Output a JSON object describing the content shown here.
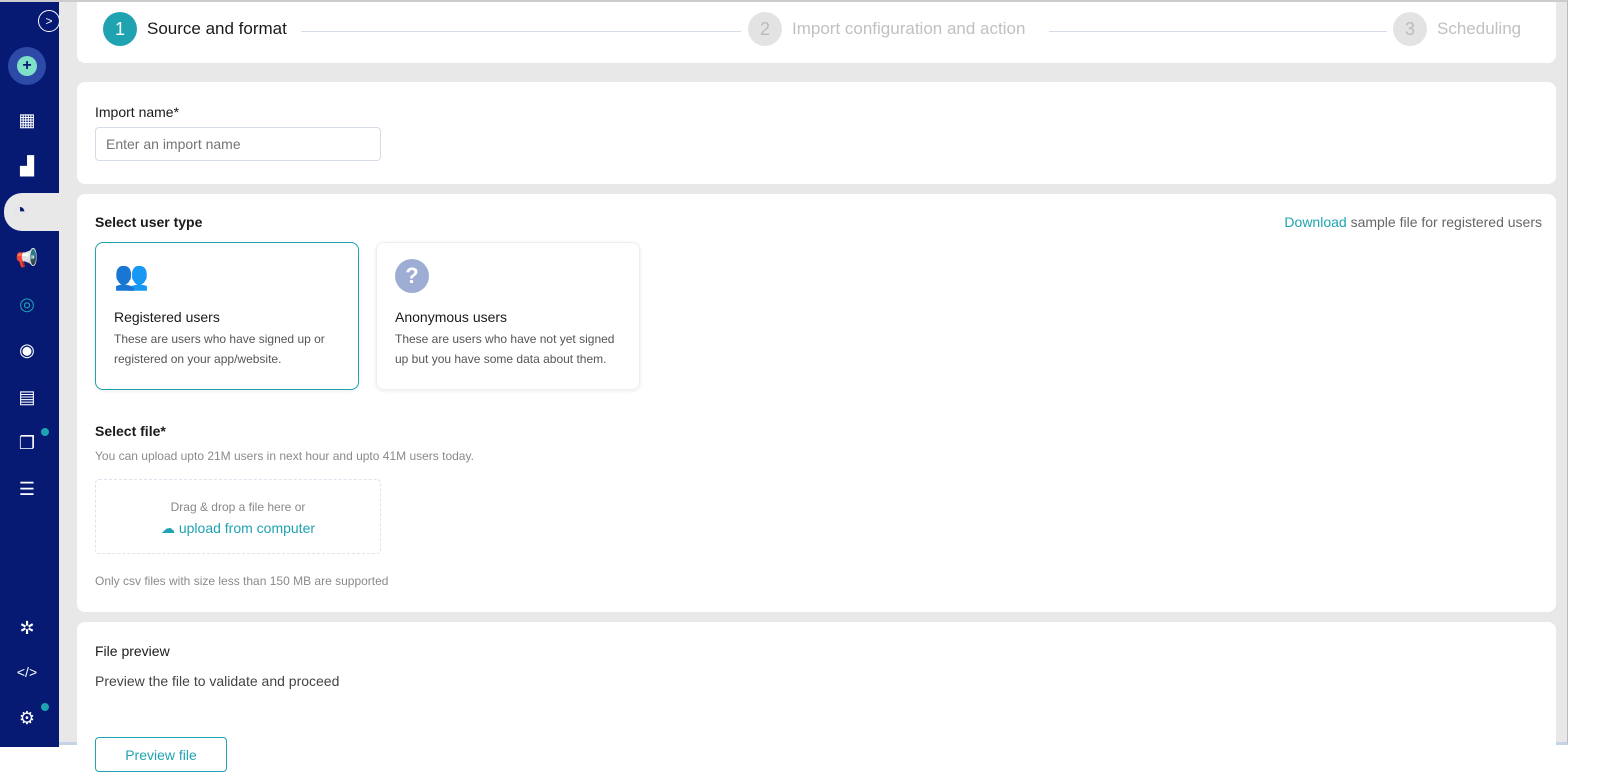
{
  "stepper": [
    {
      "num": "1",
      "label": "Source and format"
    },
    {
      "num": "2",
      "label": "Import configuration and action"
    },
    {
      "num": "3",
      "label": "Scheduling"
    }
  ],
  "import_name": {
    "label": "Import name*",
    "placeholder": "Enter an import name"
  },
  "user_type": {
    "label": "Select user type",
    "download_link": "Download",
    "download_suffix": " sample file for registered users",
    "options": [
      {
        "title": "Registered users",
        "desc": "These are users who have signed up or registered on your app/website."
      },
      {
        "title": "Anonymous users",
        "desc": "These are users who have not yet signed up but you have some data about them."
      }
    ]
  },
  "select_file": {
    "label": "Select file*",
    "limit": "You can upload upto 21M users in next hour and upto 41M users today.",
    "drop_text": "Drag & drop a file here or",
    "upload_link": "upload from computer",
    "note": "Only csv files with size less than 150 MB are supported"
  },
  "file_preview": {
    "label": "File preview",
    "desc": "Preview the file to validate and proceed",
    "button": "Preview file"
  },
  "colors": {
    "accent": "#1fa3b1",
    "sidebar": "#061a73"
  }
}
